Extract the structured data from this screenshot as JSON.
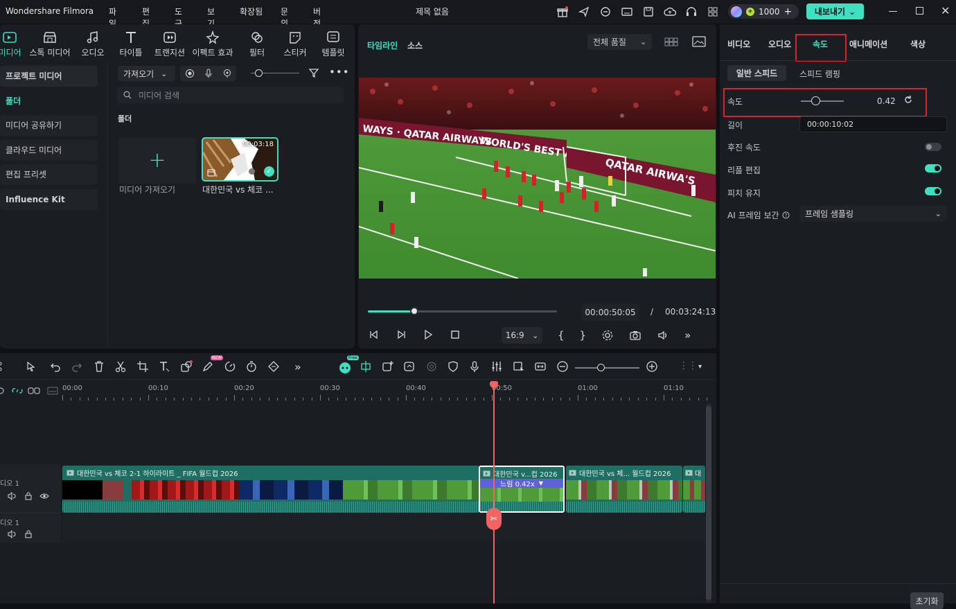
{
  "app": {
    "name": "Wondershare Filmora",
    "project_title": "제목 없음",
    "credits": "1000",
    "export_label": "내보내기"
  },
  "menu": [
    "파일",
    "편집",
    "도구",
    "보기",
    "확장됨",
    "문의",
    "버전"
  ],
  "media_tabs": [
    {
      "label": "미디어",
      "icon": "media-icon"
    },
    {
      "label": "스톡 미디어",
      "icon": "stock-icon"
    },
    {
      "label": "오디오",
      "icon": "music-icon"
    },
    {
      "label": "타이틀",
      "icon": "title-icon"
    },
    {
      "label": "트랜지션",
      "icon": "transition-icon"
    },
    {
      "label": "이펙트 효과",
      "icon": "effect-icon"
    },
    {
      "label": "필터",
      "icon": "filter-icon"
    },
    {
      "label": "스티커",
      "icon": "sticker-icon"
    },
    {
      "label": "템플릿",
      "icon": "template-icon"
    }
  ],
  "sidebar": [
    "프로젝트 미디어",
    "폴더",
    "미디어 공유하기",
    "클라우드 미디어",
    "편집 프리셋",
    "Influence Kit"
  ],
  "media": {
    "import_label": "가져오기",
    "search_placeholder": "미디어 검색",
    "folder_label": "폴더",
    "import_tile_label": "미디어 가져오기",
    "clip_label": "대한민국 vs 체코 ...",
    "clip_duration": "00:03:18"
  },
  "preview": {
    "tabs": [
      "타임라인",
      "소스"
    ],
    "quality": "전체 품질",
    "current_time": "00:00:50:05",
    "separator": "/",
    "total_time": "00:03:24:13",
    "aspect": "16:9",
    "progress": 0.245,
    "scene": {
      "board1": "WAYS · QATAR AIRWAYS",
      "board2": "WORLD'S BEST AIRLINE",
      "board3": "QATAR AIRWA'S"
    }
  },
  "props": {
    "tabs": [
      "비디오",
      "오디오",
      "속도",
      "애니메이션",
      "색상"
    ],
    "active_tab": "속도",
    "subtabs": [
      "일반 스피드",
      "스피드 램핑"
    ],
    "speed_label": "속도",
    "speed_value": "0.42",
    "speed_slider": 0.42,
    "duration_label": "길이",
    "duration_value": "00:00:10:02",
    "reverse_label": "후진 속도",
    "ripple_label": "리플 편집",
    "pitch_label": "피치 유지",
    "ai_label": "AI 프레임 보간",
    "ai_value": "프레임 샘플링",
    "reset_label": "초기화",
    "accent": "#3fe0c1",
    "highlight": "#e0202a"
  },
  "timeline": {
    "ruler": [
      "00:00",
      "00:10",
      "00:20",
      "00:30",
      "00:40",
      "00:50",
      "01:00",
      "01:10"
    ],
    "video_track_label": "디오 1",
    "audio_track_label": "디오 1",
    "clip1_title": "대한민국 vs 체코 2-1 하이라이트 _ FIFA 월드컵 2026",
    "clip2_title": "대한민국 v...컵 2026",
    "clip2_speed": "느림 0.42x",
    "clip3_title": "대한민국 vs 체... 월드컵 2026",
    "clip4_title": "대",
    "badge_new": "NEW",
    "badge_free": "Free"
  }
}
